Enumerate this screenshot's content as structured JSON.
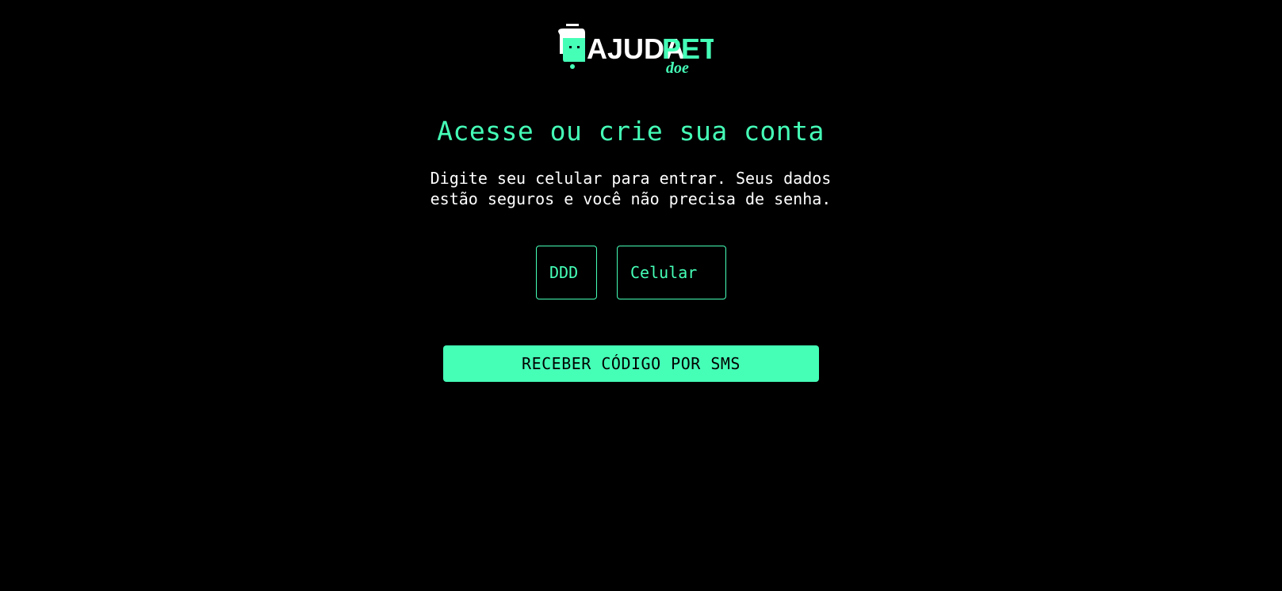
{
  "logo": {
    "icon": "pet-icon",
    "main_text_white": "AJUDA",
    "main_text_green": "PET",
    "sub_text": "doe",
    "accent_color": "#45ffb7"
  },
  "heading": {
    "title": "Acesse ou crie sua conta",
    "subtitle_line1": "Digite seu celular para entrar. Seus dados",
    "subtitle_line2": "estão seguros e você não precisa de senha."
  },
  "form": {
    "ddd_placeholder": "DDD",
    "ddd_value": "",
    "cellphone_placeholder": "Celular",
    "cellphone_value": "",
    "submit_label": "RECEBER CÓDIGO POR SMS"
  },
  "colors": {
    "background": "#000000",
    "accent": "#45ffb7",
    "text": "#ffffff"
  }
}
